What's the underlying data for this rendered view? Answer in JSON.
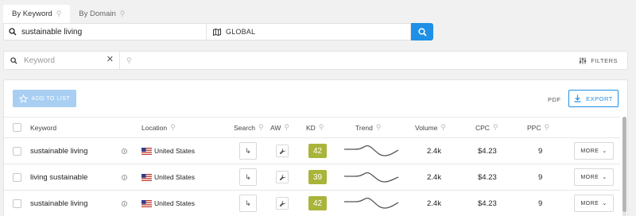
{
  "tabs": [
    {
      "label": "By Keyword",
      "active": true
    },
    {
      "label": "By Domain",
      "active": false
    }
  ],
  "search": {
    "query": "sustainable living",
    "location": "GLOBAL"
  },
  "filter": {
    "placeholder": "Keyword",
    "filters_label": "FILTERS"
  },
  "toolbar": {
    "add_to_list": "ADD TO LIST",
    "pdf": "PDF",
    "export": "EXPORT"
  },
  "table": {
    "headers": {
      "keyword": "Keyword",
      "location": "Location",
      "search": "Search",
      "aw": "AW",
      "kd": "KD",
      "trend": "Trend",
      "volume": "Volume",
      "cpc": "CPC",
      "ppc": "PPC"
    },
    "rows": [
      {
        "keyword": "sustainable living",
        "location": "United States",
        "kd": "42",
        "kd_color": "#a9b43a",
        "volume": "2.4k",
        "cpc": "$4.23",
        "ppc": "9",
        "more": "MORE"
      },
      {
        "keyword": "living sustainable",
        "location": "United States",
        "kd": "39",
        "kd_color": "#a9b43a",
        "volume": "2.4k",
        "cpc": "$4.23",
        "ppc": "9",
        "more": "MORE"
      },
      {
        "keyword": "sustainable living",
        "location": "United States",
        "kd": "42",
        "kd_color": "#a9b43a",
        "volume": "2.4k",
        "cpc": "$4.23",
        "ppc": "9",
        "more": "MORE"
      }
    ]
  },
  "colors": {
    "accent": "#1e90e6",
    "kd_badge": "#a9b43a",
    "add_to_list_bg": "#a8cff2"
  },
  "icons": {
    "search": "search-icon",
    "location": "map-icon",
    "clear": "close-icon",
    "filters": "sliders-icon",
    "add_to_list": "star-icon",
    "export": "download-icon",
    "search_volume": "arrow-turn-icon",
    "aw": "wrench-icon",
    "more": "chevron-down-icon",
    "pin": "pin-icon"
  }
}
